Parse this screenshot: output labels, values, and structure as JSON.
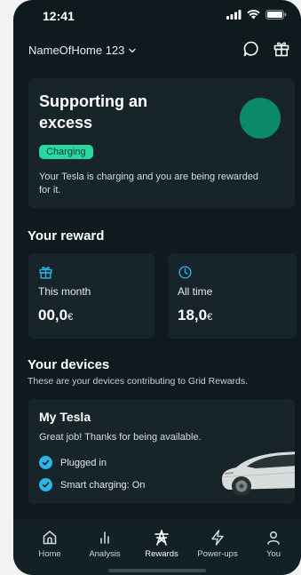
{
  "status_bar": {
    "time": "12:41"
  },
  "header": {
    "home_name": "NameOfHome 123"
  },
  "hero": {
    "title": "Supporting an excess",
    "badge": "Charging",
    "description": "Your Tesla is charging and you are being rewarded for it.",
    "accent_color": "#0a8a6a"
  },
  "reward": {
    "title": "Your reward",
    "this_month": {
      "label": "This month",
      "value": "00,0",
      "unit": "€"
    },
    "all_time": {
      "label": "All time",
      "value": "18,0",
      "unit": "€"
    }
  },
  "devices": {
    "title": "Your devices",
    "subtitle": "These are your devices contributing to Grid Rewards.",
    "device": {
      "name": "My Tesla",
      "description": "Great job! Thanks for being available.",
      "checks": [
        "Plugged in",
        "Smart charging: On"
      ]
    }
  },
  "tabs": [
    {
      "label": "Home",
      "icon": "home-icon"
    },
    {
      "label": "Analysis",
      "icon": "bar-chart-icon"
    },
    {
      "label": "Rewards",
      "icon": "power-tower-icon",
      "active": true
    },
    {
      "label": "Power-ups",
      "icon": "bolt-icon"
    },
    {
      "label": "You",
      "icon": "person-icon"
    }
  ]
}
